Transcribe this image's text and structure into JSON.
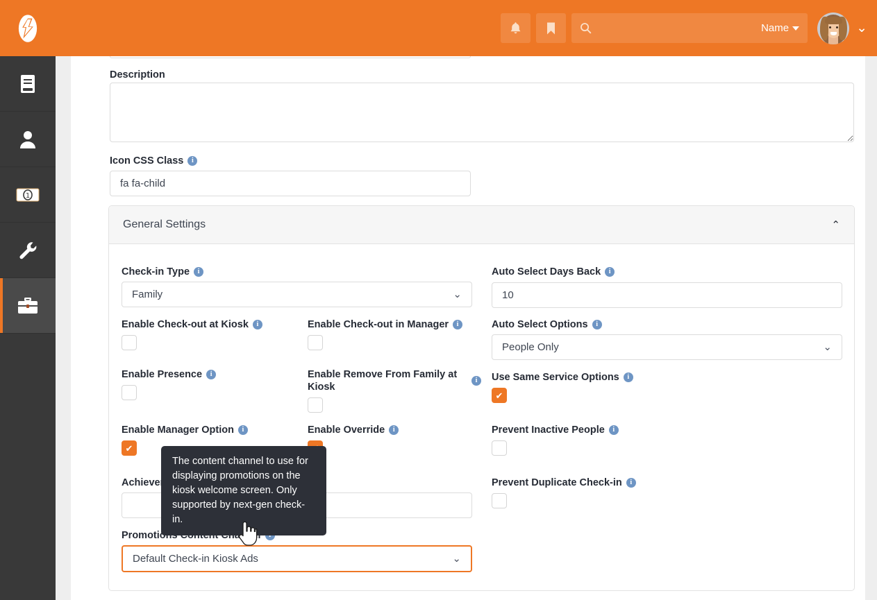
{
  "topbar": {
    "logo_name": "rock-logo",
    "notifications_icon": "bell-icon",
    "bookmark_icon": "bookmark-icon",
    "search": {
      "icon": "search-icon",
      "value": "",
      "placeholder": ""
    },
    "name_dropdown_label": "Name",
    "avatar_name": "user-avatar",
    "user_caret_icon": "chevron-down-icon"
  },
  "sidebar": {
    "items": [
      {
        "icon": "book-icon",
        "label": ""
      },
      {
        "icon": "person-icon",
        "label": ""
      },
      {
        "icon": "money-bill-icon",
        "label": ""
      },
      {
        "icon": "wrench-icon",
        "label": ""
      },
      {
        "icon": "briefcase-icon",
        "label": "",
        "active": true
      }
    ]
  },
  "form": {
    "description": {
      "label": "Description",
      "value": "",
      "placeholder": ""
    },
    "icon_css_class": {
      "label": "Icon CSS Class",
      "value": "fa fa-child",
      "placeholder": "",
      "info": "i"
    }
  },
  "panel": {
    "title": "General Settings",
    "collapse_icon": "chevron-up-icon",
    "left_column": [
      {
        "type": "select",
        "label": "Check-in Type",
        "value": "Family",
        "info": "i"
      },
      {
        "type": "checkbox",
        "label": "Enable Check-out at Kiosk",
        "checked": false,
        "info": "i"
      },
      {
        "type": "checkbox",
        "label": "Enable Presence",
        "checked": false,
        "info": "i"
      },
      {
        "type": "checkbox",
        "label": "Enable Manager Option",
        "checked": true,
        "info": "i"
      },
      {
        "type": "text",
        "label": "Achievement",
        "value": "",
        "placeholder": ""
      },
      {
        "type": "select",
        "label": "Promotions Content Channel",
        "value": "Default Check-in Kiosk Ads",
        "info": "i",
        "focused": true
      }
    ],
    "middle_column": [
      {
        "type": "checkbox",
        "label": "Enable Check-out in Manager",
        "checked": false,
        "info": "i"
      },
      {
        "type": "checkbox",
        "label": "Enable Remove From Family at Kiosk",
        "checked": false,
        "info": "i"
      },
      {
        "type": "checkbox",
        "label": "Enable Override",
        "checked": true,
        "info": "i"
      }
    ],
    "right_column": [
      {
        "type": "text",
        "label": "Auto Select Days Back",
        "value": "10",
        "info": "i"
      },
      {
        "type": "select",
        "label": "Auto Select Options",
        "value": "People Only",
        "info": "i"
      },
      {
        "type": "checkbox",
        "label": "Use Same Service Options",
        "checked": true,
        "info": "i"
      },
      {
        "type": "checkbox",
        "label": "Prevent Inactive People",
        "checked": false,
        "info": "i"
      },
      {
        "type": "checkbox",
        "label": "Prevent Duplicate Check-in",
        "checked": false,
        "info": "i"
      }
    ]
  },
  "tooltip": {
    "text": "The content channel to use for displaying promotions on the kiosk welcome screen. Only supported by next-gen check-in."
  },
  "colors": {
    "brand_orange": "#ee7725",
    "rail_dark": "#393939",
    "rail_active": "#4a4a4a",
    "label_navy": "#262b35",
    "info_blue": "#6e95c4",
    "tooltip_bg": "#2d3038"
  }
}
